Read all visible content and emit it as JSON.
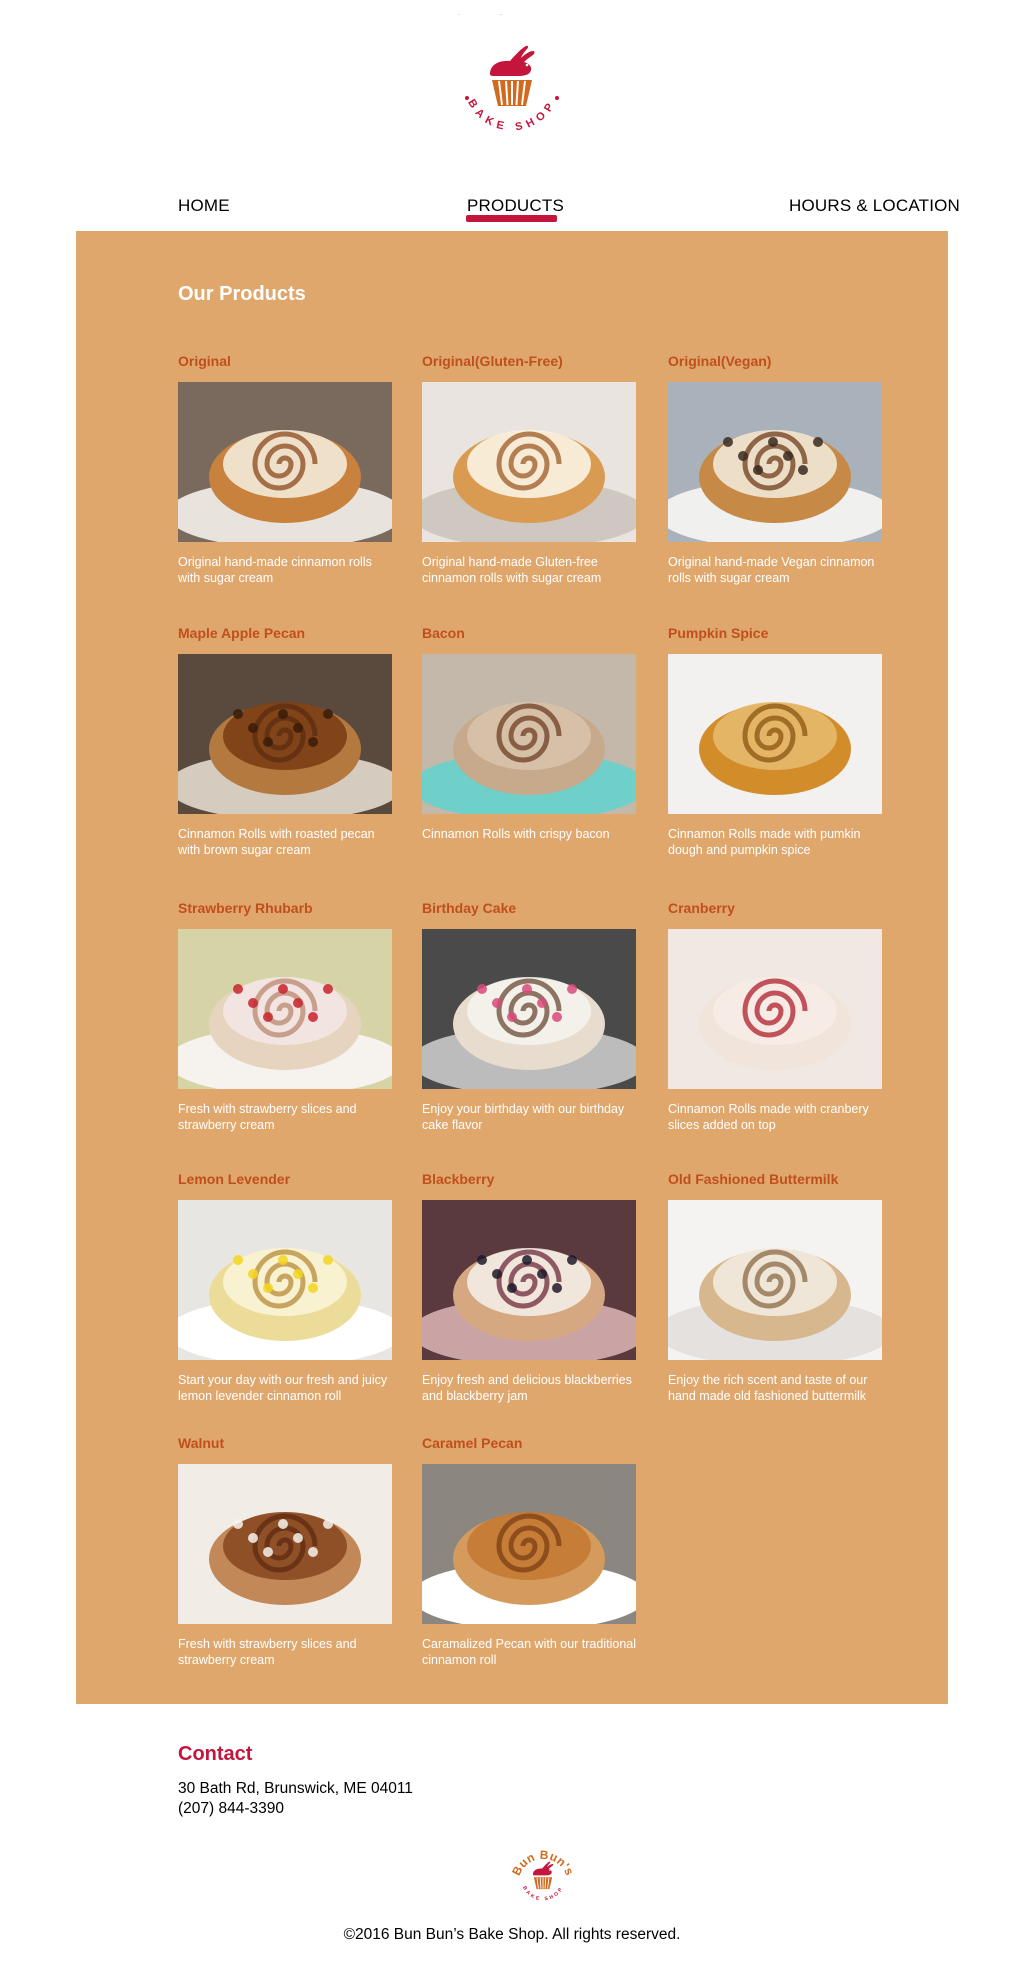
{
  "brand": {
    "logo_name": "Bun Bun's",
    "logo_sub": "BAKE SHOP",
    "brand_color": "#c4163c",
    "accent_color": "#d2691e"
  },
  "nav": {
    "home": "HOME",
    "products": "PRODUCTS",
    "hours": "HOURS & LOCATION",
    "active": "PRODUCTS"
  },
  "products": {
    "title": "Our Products",
    "panel_color": "#e0a76d",
    "items": [
      {
        "name": "Original",
        "desc": "Original hand-made cinnamon rolls with sugar cream",
        "image": "cinnamon-roll-icing"
      },
      {
        "name": "Original(Gluten-Free)",
        "desc": "Original hand-made Gluten-free cinnamon rolls with sugar cream",
        "image": "cinnamon-roll-gluten-free"
      },
      {
        "name": "Original(Vegan)",
        "desc": "Original hand-made Vegan cinnamon rolls with sugar cream",
        "image": "vegan-rolls-plate"
      },
      {
        "name": "Maple Apple Pecan",
        "desc": "Cinnamon Rolls with roasted pecan with brown sugar cream",
        "image": "maple-pecan-roll"
      },
      {
        "name": "Bacon",
        "desc": "Cinnamon Rolls with crispy bacon",
        "image": "bacon-rolls-basket"
      },
      {
        "name": "Pumpkin Spice",
        "desc": "Cinnamon Rolls made with pumkin dough and pumpkin spice",
        "image": "pumpkin-roll"
      },
      {
        "name": "Strawberry Rhubarb",
        "desc": "Fresh with strawberry slices and strawberry cream",
        "image": "strawberry-roll-plate"
      },
      {
        "name": "Birthday Cake",
        "desc": "Enjoy your birthday with our birthday cake flavor",
        "image": "sprinkle-rolls-pan"
      },
      {
        "name": "Cranberry",
        "desc": "Cinnamon Rolls made with cranbery slices added on top",
        "image": "cranberry-swirl-rolls"
      },
      {
        "name": "Lemon Levender",
        "desc": "Start your day with our fresh and juicy lemon levender cinnamon roll",
        "image": "lemon-lavender-rolls"
      },
      {
        "name": "Blackberry",
        "desc": "Enjoy fresh and delicious blackberries and blackberry jam",
        "image": "blackberry-rolls"
      },
      {
        "name": "Old Fashioned Buttermilk",
        "desc": "Enjoy the rich scent and taste of our hand made old fashioned buttermilk",
        "image": "buttermilk-roll"
      },
      {
        "name": "Walnut",
        "desc": "Fresh with strawberry slices and strawberry cream",
        "image": "walnut-rolls"
      },
      {
        "name": "Caramel Pecan",
        "desc": "Caramalized Pecan with our traditional cinnamon roll",
        "image": "caramel-pecan-rolls"
      }
    ]
  },
  "contact": {
    "title": "Contact",
    "address": "30 Bath Rd, Brunswick, ME 04011",
    "phone": "(207) 844-3390"
  },
  "footer": {
    "copyright": "©2016 Bun Bun’s Bake Shop. All rights reserved."
  }
}
